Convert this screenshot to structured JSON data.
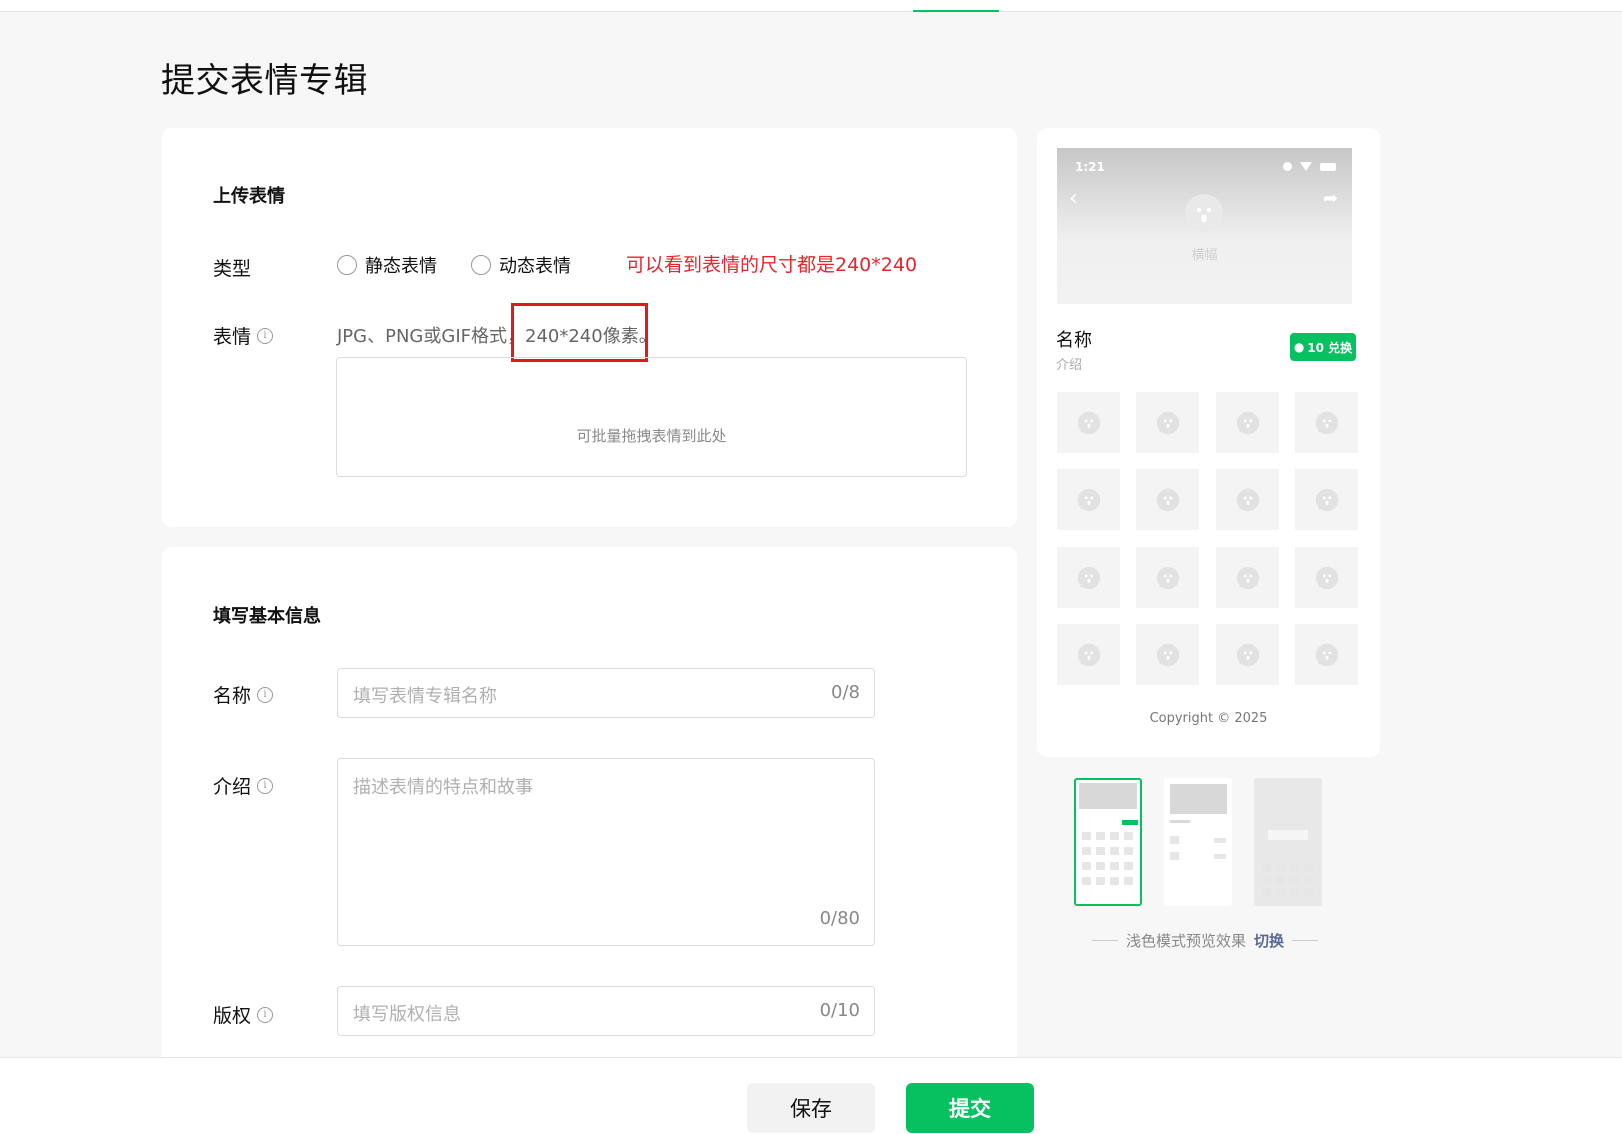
{
  "page": {
    "title": "提交表情专辑"
  },
  "upload": {
    "section_title": "上传表情",
    "type_label": "类型",
    "radio_static": "静态表情",
    "radio_animated": "动态表情",
    "annotation": "可以看到表情的尺寸都是240*240",
    "sticker_label": "表情",
    "hint": "JPG、PNG或GIF格式，240*240像素。",
    "dropzone_text": "可批量拖拽表情到此处"
  },
  "basic": {
    "section_title": "填写基本信息",
    "name_label": "名称",
    "name_placeholder": "填写表情专辑名称",
    "name_count": "0/8",
    "intro_label": "介绍",
    "intro_placeholder": "描述表情的特点和故事",
    "intro_count": "0/80",
    "copyright_label": "版权",
    "copyright_placeholder": "填写版权信息",
    "copyright_count": "0/10"
  },
  "preview": {
    "status_time": "1:21",
    "banner_name": "横幅",
    "name": "名称",
    "intro": "介绍",
    "exchange_button": "10 兑换",
    "copyright": "Copyright © 2025",
    "mode_text": "浅色模式预览效果",
    "switch_link": "切换"
  },
  "footer": {
    "save_label": "保存",
    "submit_label": "提交"
  },
  "colors": {
    "brand_green": "#07c160",
    "annotation_red": "#e8252c",
    "link_blue": "#576b95"
  }
}
